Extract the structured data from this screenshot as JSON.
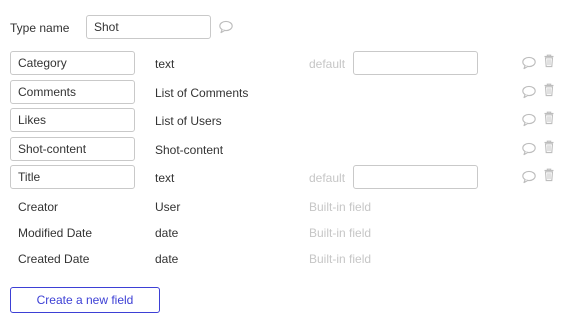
{
  "type_name": {
    "label": "Type name",
    "value": "Shot"
  },
  "fields": [
    {
      "name": "Category",
      "type": "text",
      "default_label": "default",
      "default_value": ""
    },
    {
      "name": "Comments",
      "type": "List of Comments"
    },
    {
      "name": "Likes",
      "type": "List of Users"
    },
    {
      "name": "Shot-content",
      "type": "Shot-content"
    },
    {
      "name": "Title",
      "type": "text",
      "default_label": "default",
      "default_value": ""
    }
  ],
  "builtin_fields": [
    {
      "name": "Creator",
      "type": "User",
      "note": "Built-in field"
    },
    {
      "name": "Modified Date",
      "type": "date",
      "note": "Built-in field"
    },
    {
      "name": "Created Date",
      "type": "date",
      "note": "Built-in field"
    }
  ],
  "create_button": "Create a new field",
  "icons": {
    "comment": "comment-bubble-icon",
    "delete": "trash-icon"
  },
  "colors": {
    "accent": "#3d40d5",
    "muted_text": "#c6c6c6",
    "border": "#c9c9c9"
  }
}
